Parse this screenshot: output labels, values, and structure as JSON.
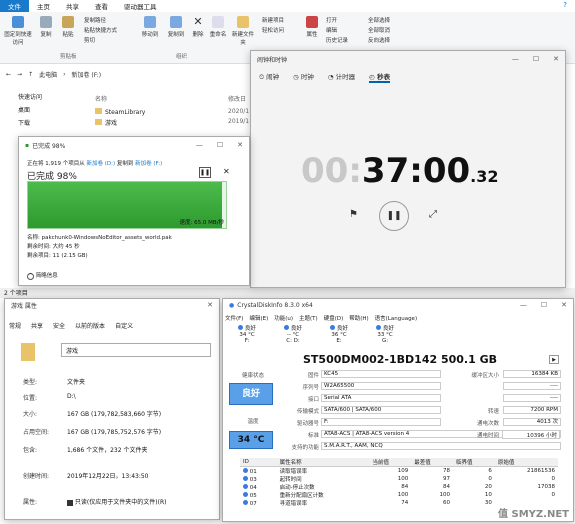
{
  "explorer": {
    "tabs": [
      "文件",
      "主页",
      "共享",
      "查看",
      "驱动器工具"
    ],
    "ribbon": {
      "pin": "固定到快速访问",
      "copy": "复制",
      "paste": "粘贴",
      "copy_path": "复制路径",
      "paste_shortcut": "粘贴快捷方式",
      "cut": "剪切",
      "clipboard": "剪贴板",
      "move_to": "移动到",
      "copy_to": "复制到",
      "delete": "删除",
      "rename": "重命名",
      "organize": "组织",
      "new_folder": "新建文件夹",
      "new_item": "新建项目",
      "easy_access": "轻松访问",
      "properties": "属性",
      "open": "打开",
      "edit": "编辑",
      "history": "历史记录",
      "select_all": "全部选择",
      "select_none": "全部取消",
      "invert": "反向选择"
    },
    "breadcrumb": [
      "此电脑",
      "新加卷 (F:)"
    ],
    "column_name": "名称",
    "column_date": "修改日",
    "files": [
      {
        "name": "SteamLibrary",
        "date": "2020/1"
      },
      {
        "name": "游戏",
        "date": "2019/1"
      }
    ],
    "sidebar": [
      "快速访问",
      "桌面",
      "下载"
    ],
    "status": "2 个项目"
  },
  "clock": {
    "title": "闹钟和时钟",
    "tabs": [
      "闹钟",
      "时钟",
      "计时器",
      "秒表"
    ],
    "active_tab": "秒表",
    "time_dim": "00:",
    "time_main": "37:00",
    "time_ms": ".32"
  },
  "copy_dialog": {
    "title": "已完成 98%",
    "line1_prefix": "正在将 1,919 个项目从",
    "source": "新加卷 (D:)",
    "line1_mid": "复制到",
    "dest": "新加卷 (F:)",
    "progress_text": "已完成 98%",
    "progress": 0.98,
    "speed": "速度: 65.0 MB/秒",
    "name": "名称: pakchunk0-WindowsNoEditor_assets_world.pak",
    "remaining_time": "剩余时间: 大约 45 秒",
    "remaining_items": "剩余项目: 11 (2.15 GB)",
    "less_info": "简略信息"
  },
  "properties": {
    "title": "游戏 属性",
    "tabs": [
      "常规",
      "共享",
      "安全",
      "以前的版本",
      "自定义"
    ],
    "name": "游戏",
    "rows": [
      {
        "label": "类型:",
        "value": "文件夹"
      },
      {
        "label": "位置:",
        "value": "D:\\"
      },
      {
        "label": "大小:",
        "value": "167 GB (179,782,583,660 字节)"
      },
      {
        "label": "占用空间:",
        "value": "167 GB (179,785,752,576 字节)"
      },
      {
        "label": "包含:",
        "value": "1,686 个文件，232 个文件夹"
      },
      {
        "label": "创建时间:",
        "value": "2019年12月22日，13:43:50"
      },
      {
        "label": "属性:",
        "value": "只读(仅应用于文件夹中的文件)(R)"
      }
    ]
  },
  "cdi": {
    "title": "CrystalDiskInfo 8.3.0 x64",
    "menu": [
      "文件(F)",
      "编辑(E)",
      "功能(u)",
      "主题(T)",
      "硬盘(D)",
      "帮助(H)",
      "语言(Language)"
    ],
    "drives": [
      {
        "status": "良好",
        "temp": "34 °C",
        "letter": "F:"
      },
      {
        "status": "良好",
        "temp": "-- °C",
        "letter": "C: D:"
      },
      {
        "status": "良好",
        "temp": "36 °C",
        "letter": "E:"
      },
      {
        "status": "良好",
        "temp": "33 °C",
        "letter": "G:"
      }
    ],
    "model": "ST500DM002-1BD142 500.1 GB",
    "health_label": "健康状态",
    "health": "良好",
    "temp_label": "温度",
    "temp": "34 °C",
    "fields_left": [
      {
        "label": "固件",
        "value": "KC45"
      },
      {
        "label": "序列号",
        "value": "W2A65500"
      },
      {
        "label": "接口",
        "value": "Serial ATA"
      },
      {
        "label": "传输模式",
        "value": "SATA/600 | SATA/600"
      },
      {
        "label": "驱动器号",
        "value": "F:"
      },
      {
        "label": "标准",
        "value": "ATA8-ACS | ATA8-ACS version 4"
      },
      {
        "label": "支持的功能",
        "value": "S.M.A.R.T., AAM, NCQ"
      }
    ],
    "fields_right": [
      {
        "label": "缓冲区大小",
        "value": "16384 KB"
      },
      {
        "label": "",
        "value": "----"
      },
      {
        "label": "",
        "value": "----"
      },
      {
        "label": "转速",
        "value": "7200 RPM"
      },
      {
        "label": "通电次数",
        "value": "4013 次"
      },
      {
        "label": "通电时间",
        "value": "10396 小时"
      }
    ],
    "columns": [
      "ID",
      "属性名称",
      "当前值",
      "最差值",
      "临界值",
      "原始值"
    ],
    "rows": [
      [
        "01",
        "读取错误率",
        "109",
        "78",
        "6",
        "21861536"
      ],
      [
        "03",
        "起转时间",
        "100",
        "97",
        "0",
        "0"
      ],
      [
        "04",
        "启动-停止次数",
        "84",
        "84",
        "20",
        "17038"
      ],
      [
        "05",
        "重新分配扇区计数",
        "100",
        "100",
        "10",
        "0"
      ],
      [
        "07",
        "寻道错误率",
        "74",
        "60",
        "30",
        ""
      ]
    ]
  },
  "watermark": "值 SMYZ.NET"
}
